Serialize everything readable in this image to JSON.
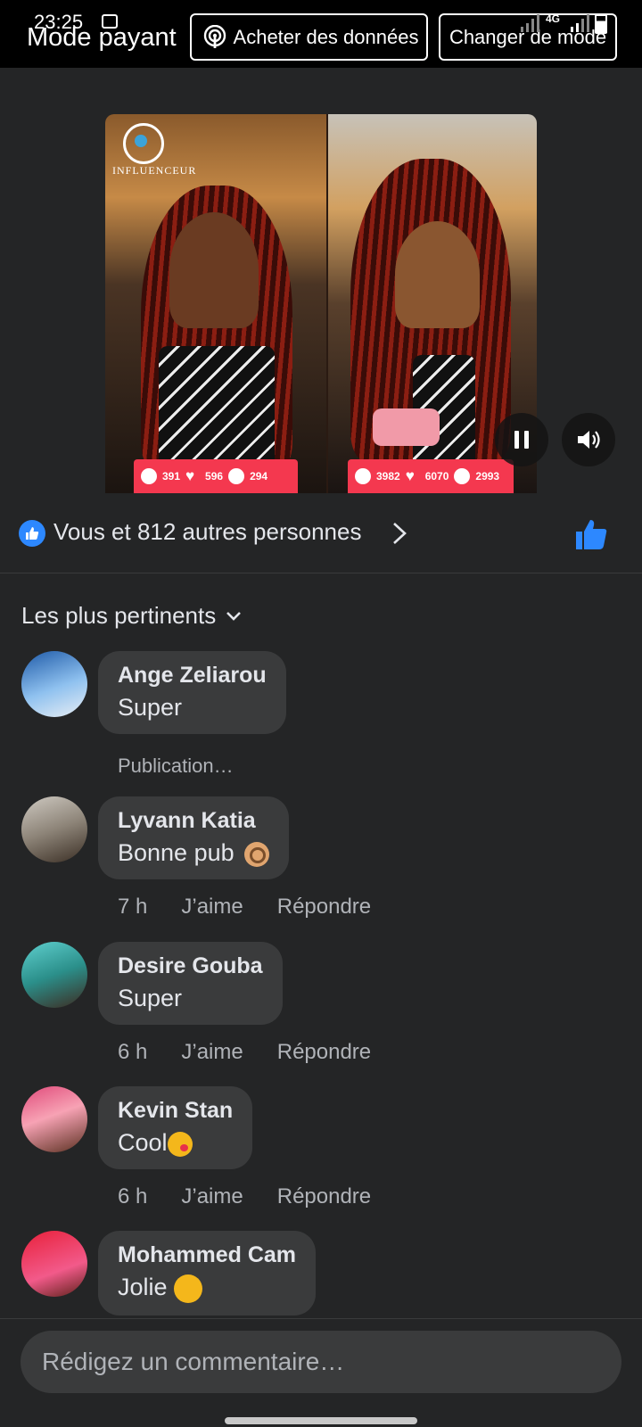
{
  "status": {
    "time": "23:25",
    "network": "4G"
  },
  "topbar": {
    "mode_title": "Mode payant",
    "buy_button": "Acheter des données",
    "change_button": "Changer de mode"
  },
  "video": {
    "brand": "INFLUENCEUR",
    "left_stats": {
      "comments": "391",
      "likes": "596",
      "shares": "294"
    },
    "right_stats": {
      "comments": "3982",
      "likes": "6070",
      "shares": "2993"
    }
  },
  "reactions": {
    "text": "Vous et 812 autres personnes"
  },
  "sort": {
    "label": "Les plus pertinents"
  },
  "comments": [
    {
      "name": "Ange Zeliarou",
      "text": "Super",
      "note": "Publication…"
    },
    {
      "name": "Lyvann Katia",
      "text": "Bonne pub",
      "time": "7 h",
      "like": "J’aime",
      "reply": "Répondre"
    },
    {
      "name": "Desire Gouba",
      "text": "Super",
      "time": "6 h",
      "like": "J’aime",
      "reply": "Répondre"
    },
    {
      "name": "Kevin Stan",
      "text": "Cool",
      "time": "6 h",
      "like": "J’aime",
      "reply": "Répondre"
    },
    {
      "name": "Mohammed Cam",
      "text": "Jolie"
    }
  ],
  "composer": {
    "placeholder": "Rédigez un commentaire…"
  },
  "colors": {
    "accent": "#2d88ff",
    "background": "#242526",
    "bubble": "#3a3b3c",
    "stats_bar": "#f4384f"
  },
  "icons": [
    "podcast-icon",
    "play-pause-icon",
    "sound-icon",
    "like-icon",
    "chevron-right-icon",
    "chevron-down-icon"
  ]
}
